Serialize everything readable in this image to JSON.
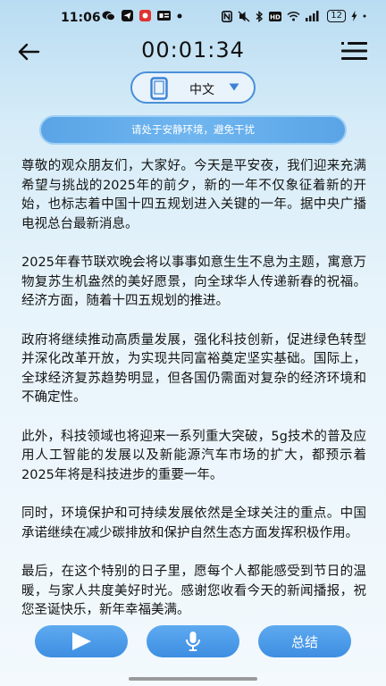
{
  "status_bar": {
    "time": "11:06",
    "battery": "12"
  },
  "header": {
    "timer": "00:01:34"
  },
  "language": {
    "label": "中文"
  },
  "notice": "请处于安静环境，避免干扰",
  "article": {
    "paragraphs": [
      "尊敬的观众朋友们，大家好。今天是平安夜，我们迎来充满希望与挑战的2025年的前夕，新的一年不仅象征着新的开始，也标志着中国十四五规划进入关键的一年。据中央广播电视总台最新消息。",
      "2025年春节联欢晚会将以事事如意生生不息为主题，寓意万物复苏生机盎然的美好愿景，向全球华人传递新春的祝福。经济方面，随着十四五规划的推进。",
      "政府将继续推动高质量发展，强化科技创新，促进绿色转型并深化改革开放，为实现共同富裕奠定坚实基础。国际上，全球经济复苏趋势明显，但各国仍需面对复杂的经济环境和不确定性。",
      "此外，科技领域也将迎来一系列重大突破，5g技术的普及应用人工智能的发展以及新能源汽车市场的扩大，都预示着2025年将是科技进步的重要一年。",
      "同时，环境保护和可持续发展依然是全球关注的重点。中国承诺继续在减少碳排放和保护自然生态方面发挥积极作用。",
      "最后，在这个特别的日子里，愿每个人都能感受到节日的温暖，与家人共度美好时光。感谢您收看今天的新闻播报，祝您圣诞快乐，新年幸福美满。"
    ]
  },
  "bottom_bar": {
    "summary_label": "总结"
  },
  "icons": {
    "back": "arrow-left-icon",
    "menu": "list-menu-icon",
    "device": "phone-icon",
    "dropdown": "caret-down-icon",
    "play": "play-icon",
    "mic": "microphone-icon"
  },
  "colors": {
    "accent": "#4a8fd8",
    "button": "#3d8ee2",
    "notice_bg": "#5aa4e6"
  }
}
